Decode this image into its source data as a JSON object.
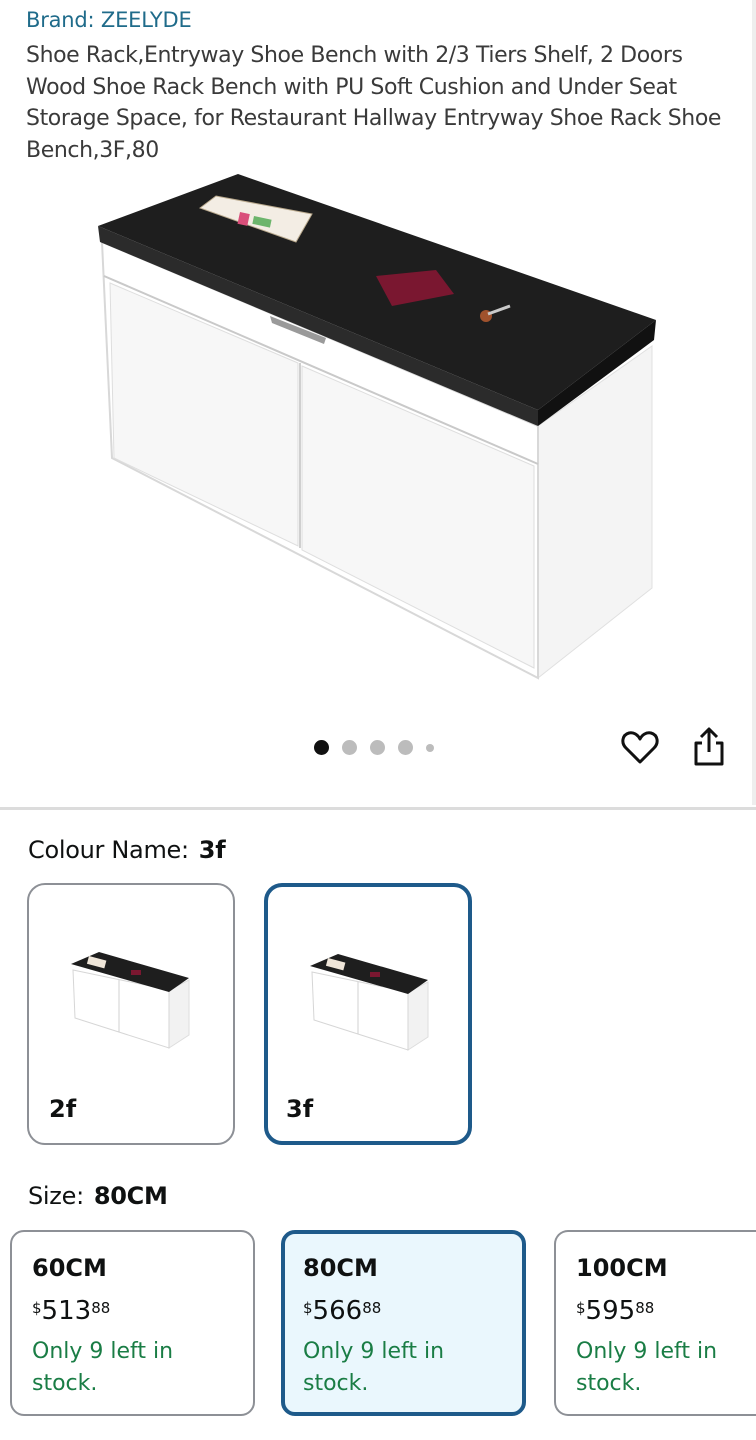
{
  "product": {
    "brand": "Brand: ZEELYDE",
    "title": "Shoe Rack,Entryway Shoe Bench with 2/3 Tiers Shelf, 2 Doors Wood Shoe Rack Bench with PU Soft Cushion and Under Seat Storage Space, for Restaurant Hallway Entryway Shoe Rack Shoe Bench,3F,80"
  },
  "gallery": {
    "image_count": 5,
    "active_index": 0,
    "icons": [
      "heart-icon",
      "share-icon"
    ]
  },
  "colour": {
    "label": "Colour Name:",
    "selected": "3f",
    "options": [
      {
        "name": "2f",
        "selected": false
      },
      {
        "name": "3f",
        "selected": true
      }
    ]
  },
  "size": {
    "label": "Size:",
    "selected": "80CM",
    "options": [
      {
        "name": "60CM",
        "currency": "$",
        "whole": "513",
        "cents": "88",
        "stock": "Only 9 left in stock.",
        "selected": false
      },
      {
        "name": "80CM",
        "currency": "$",
        "whole": "566",
        "cents": "88",
        "stock": "Only 9 left in stock.",
        "selected": true
      },
      {
        "name": "100CM",
        "currency": "$",
        "whole": "595",
        "cents": "88",
        "stock": "Only 9 left in stock.",
        "selected": false
      }
    ]
  },
  "colors": {
    "brand_link": "#1f6b8a",
    "selected_border": "#1e5a8a",
    "selected_bg": "#eaf7fd",
    "stock_green": "#1a7d45"
  }
}
